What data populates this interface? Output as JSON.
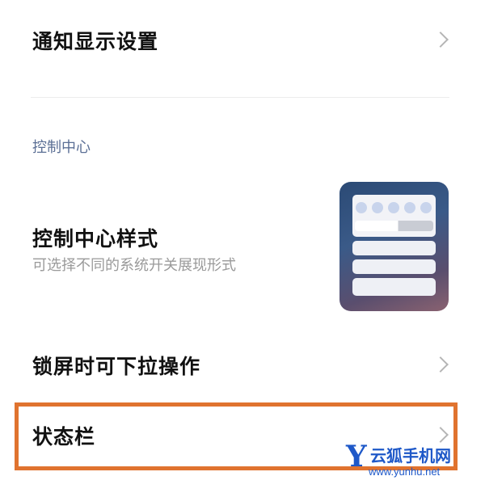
{
  "rows": {
    "notification": {
      "title": "通知显示设置"
    },
    "section_header": "控制中心",
    "control_style": {
      "title": "控制中心样式",
      "subtitle": "可选择不同的系统开关展现形式"
    },
    "lockscreen_pulldown": {
      "title": "锁屏时可下拉操作"
    },
    "status_bar": {
      "title": "状态栏"
    }
  },
  "watermark": {
    "logo_letter": "Y",
    "name": "云狐手机网",
    "url": "www.yunhu.net"
  },
  "colors": {
    "highlight": "#e0732f",
    "section_header": "#5b6f95",
    "watermark": "#1e58c8"
  },
  "icons": [
    "chevron-right-icon",
    "control-center-style-thumbnail"
  ]
}
